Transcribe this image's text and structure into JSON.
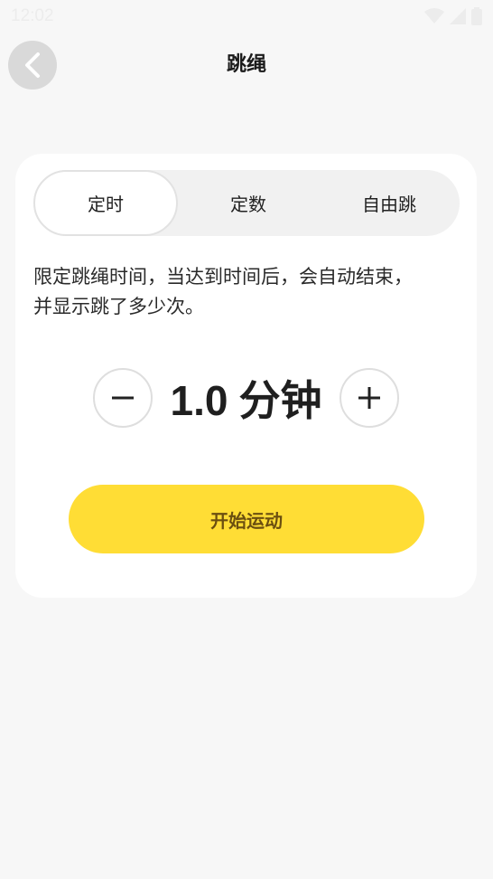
{
  "status_bar": {
    "time": "12:02"
  },
  "header": {
    "title": "跳绳"
  },
  "tabs": [
    {
      "label": "定时",
      "active": true
    },
    {
      "label": "定数",
      "active": false
    },
    {
      "label": "自由跳",
      "active": false
    }
  ],
  "description": {
    "line1": "限定跳绳时间，当达到时间后，会自动结束，",
    "line2": "并显示跳了多少次。"
  },
  "stepper": {
    "value": "1.0",
    "unit": "分钟"
  },
  "start_button": {
    "label": "开始运动"
  },
  "colors": {
    "accent": "#ffdd35",
    "accent_text": "#6b4f10",
    "background": "#f7f7f7"
  }
}
